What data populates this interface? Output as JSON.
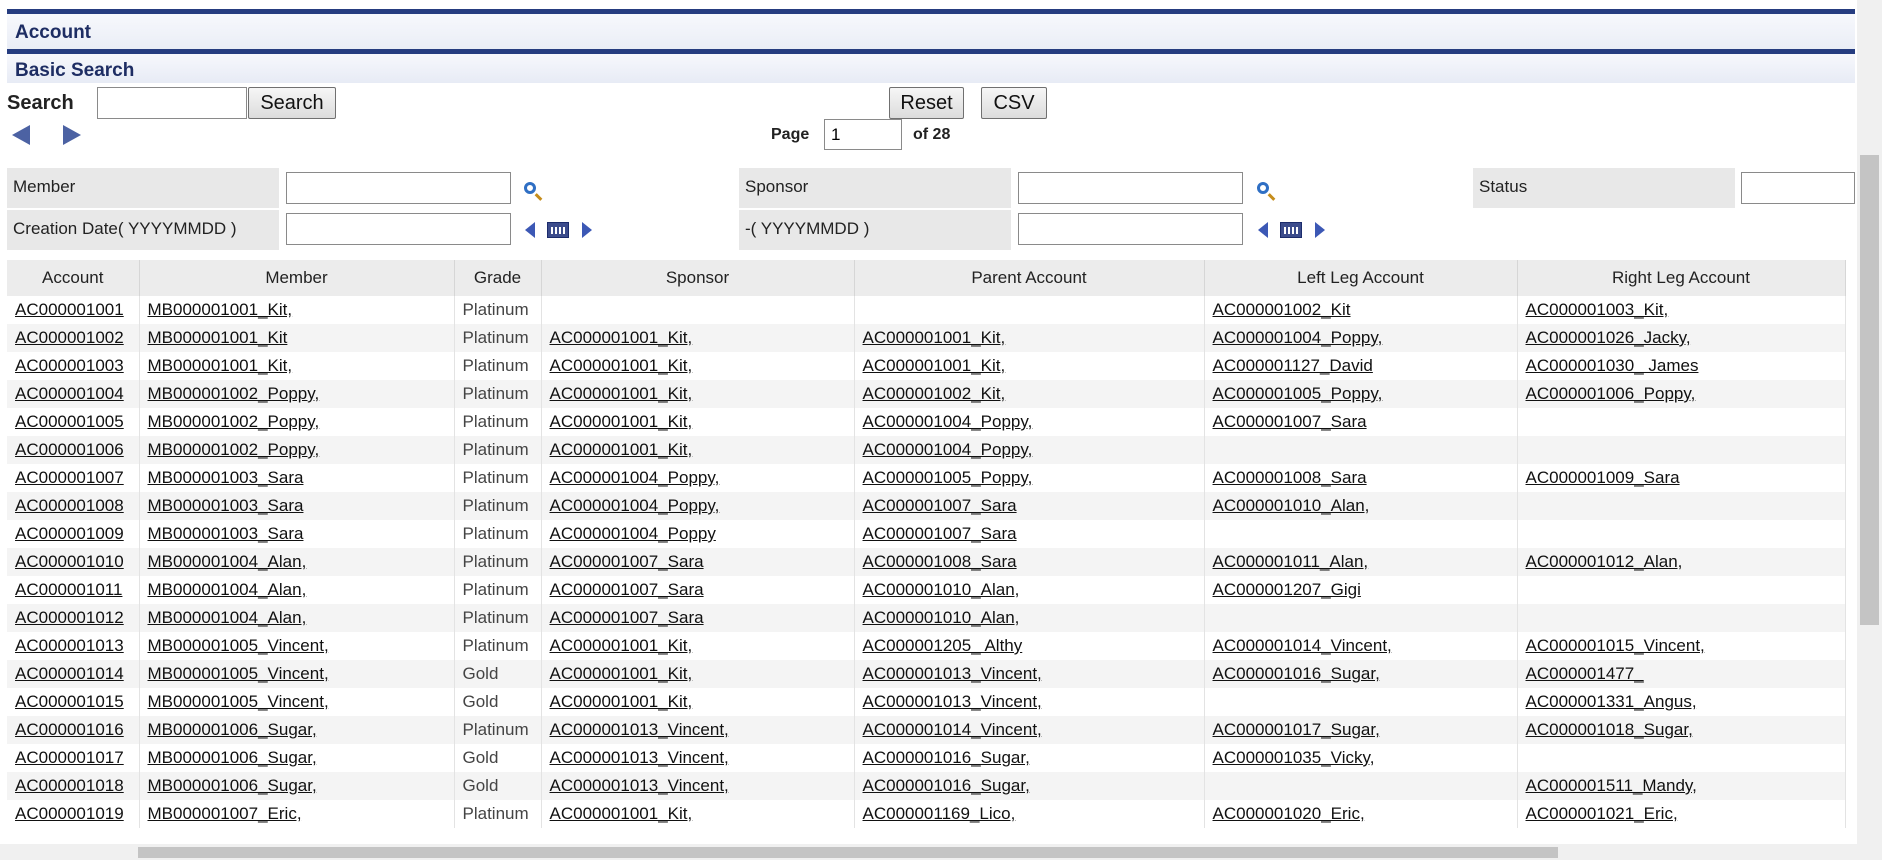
{
  "window": {
    "title": "Account"
  },
  "section": {
    "title": "Basic Search"
  },
  "search": {
    "label": "Search",
    "value": "",
    "button": "Search",
    "reset": "Reset",
    "csv": "CSV"
  },
  "pager": {
    "label": "Page",
    "current": "1",
    "of": "of 28"
  },
  "filters": {
    "member": "Member",
    "sponsor": "Sponsor",
    "status": "Status",
    "creation_date": "Creation Date( YYYYMMDD )",
    "to_date": "-( YYYYMMDD )"
  },
  "columns": [
    "Account",
    "Member",
    "Grade",
    "Sponsor",
    "Parent Account",
    "Left Leg Account",
    "Right Leg Account"
  ],
  "rows": [
    [
      "AC000001001",
      "MB000001001_Kit,",
      "Platinum",
      "",
      "",
      "AC000001002_Kit",
      "AC000001003_Kit,"
    ],
    [
      "AC000001002",
      "MB000001001_Kit",
      "Platinum",
      "AC000001001_Kit,",
      "AC000001001_Kit,",
      "AC000001004_Poppy,",
      "AC000001026_Jacky,"
    ],
    [
      "AC000001003",
      "MB000001001_Kit,",
      "Platinum",
      "AC000001001_Kit,",
      "AC000001001_Kit,",
      "AC000001127_David",
      "AC000001030_ James"
    ],
    [
      "AC000001004",
      "MB000001002_Poppy,",
      "Platinum",
      "AC000001001_Kit,",
      "AC000001002_Kit,",
      "AC000001005_Poppy,",
      "AC000001006_Poppy,"
    ],
    [
      "AC000001005",
      "MB000001002_Poppy,",
      "Platinum",
      "AC000001001_Kit,",
      "AC000001004_Poppy,",
      "AC000001007_Sara",
      ""
    ],
    [
      "AC000001006",
      "MB000001002_Poppy,",
      "Platinum",
      "AC000001001_Kit,",
      "AC000001004_Poppy,",
      "",
      ""
    ],
    [
      "AC000001007",
      "MB000001003_Sara",
      "Platinum",
      "AC000001004_Poppy,",
      "AC000001005_Poppy,",
      "AC000001008_Sara",
      "AC000001009_Sara"
    ],
    [
      "AC000001008",
      "MB000001003_Sara",
      "Platinum",
      "AC000001004_Poppy,",
      "AC000001007_Sara",
      "AC000001010_Alan,",
      ""
    ],
    [
      "AC000001009",
      "MB000001003_Sara",
      "Platinum",
      "AC000001004_Poppy",
      "AC000001007_Sara",
      "",
      ""
    ],
    [
      "AC000001010",
      "MB000001004_Alan,",
      "Platinum",
      "AC000001007_Sara",
      "AC000001008_Sara",
      "AC000001011_Alan,",
      "AC000001012_Alan,"
    ],
    [
      "AC000001011",
      "MB000001004_Alan,",
      "Platinum",
      "AC000001007_Sara",
      "AC000001010_Alan,",
      "AC000001207_Gigi",
      ""
    ],
    [
      "AC000001012",
      "MB000001004_Alan,",
      "Platinum",
      "AC000001007_Sara",
      "AC000001010_Alan,",
      "",
      ""
    ],
    [
      "AC000001013",
      "MB000001005_Vincent,",
      "Platinum",
      "AC000001001_Kit,",
      "AC000001205_ Althy",
      "AC000001014_Vincent,",
      "AC000001015_Vincent,"
    ],
    [
      "AC000001014",
      "MB000001005_Vincent,",
      "Gold",
      "AC000001001_Kit,",
      "AC000001013_Vincent,",
      "AC000001016_Sugar,",
      "AC000001477_"
    ],
    [
      "AC000001015",
      "MB000001005_Vincent,",
      "Gold",
      "AC000001001_Kit,",
      "AC000001013_Vincent,",
      "",
      "AC000001331_Angus,"
    ],
    [
      "AC000001016",
      "MB000001006_Sugar,",
      "Platinum",
      "AC000001013_Vincent,",
      "AC000001014_Vincent,",
      "AC000001017_Sugar,",
      "AC000001018_Sugar,"
    ],
    [
      "AC000001017",
      "MB000001006_Sugar,",
      "Gold",
      "AC000001013_Vincent,",
      "AC000001016_Sugar,",
      "AC000001035_Vicky,",
      ""
    ],
    [
      "AC000001018",
      "MB000001006_Sugar,",
      "Gold",
      "AC000001013_Vincent,",
      "AC000001016_Sugar,",
      "",
      "AC000001511_Mandy,"
    ],
    [
      "AC000001019",
      "MB000001007_Eric,",
      "Platinum",
      "AC000001001_Kit,",
      "AC000001169_Lico,",
      "AC000001020_Eric,",
      "AC000001021_Eric,"
    ]
  ],
  "colors": {
    "accent": "#263d80",
    "header_bg": "#ececec",
    "filter_bg": "#e8e8e8"
  },
  "icons": [
    "prev-page-icon",
    "next-page-icon",
    "search-icon",
    "calendar-icon"
  ]
}
